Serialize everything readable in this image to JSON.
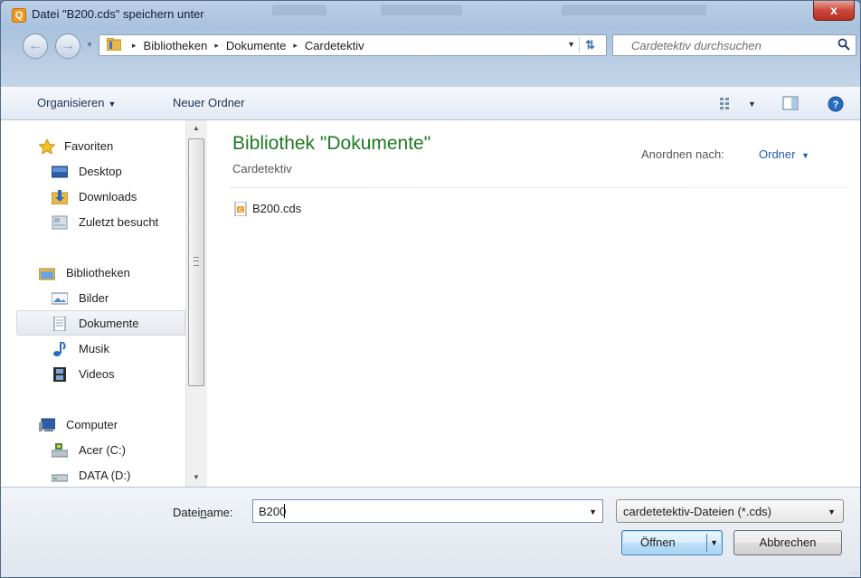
{
  "window": {
    "title": "Datei \"B200.cds\" speichern unter",
    "close_label": "x"
  },
  "address_bar": {
    "breadcrumbs": [
      "Bibliotheken",
      "Dokumente",
      "Cardetektiv"
    ],
    "separator": "▸"
  },
  "search": {
    "placeholder": "Cardetektiv durchsuchen"
  },
  "toolbar": {
    "organize_label": "Organisieren",
    "new_folder_label": "Neuer Ordner"
  },
  "nav_pane": {
    "favorites_label": "Favoriten",
    "favorites_items": [
      "Desktop",
      "Downloads",
      "Zuletzt besucht"
    ],
    "libraries_label": "Bibliotheken",
    "libraries_items": [
      "Bilder",
      "Dokumente",
      "Musik",
      "Videos"
    ],
    "computer_label": "Computer",
    "computer_items": [
      "Acer (C:)",
      "DATA (D:)"
    ],
    "selected_item": "Dokumente"
  },
  "content": {
    "library_title": "Bibliothek \"Dokumente\"",
    "library_subtitle": "Cardetektiv",
    "arrange_label": "Anordnen nach:",
    "arrange_value": "Ordner",
    "files": [
      "B200.cds"
    ]
  },
  "bottom": {
    "filename_label_pre": "Datei",
    "filename_label_underlined": "n",
    "filename_label_post": "ame:",
    "filename_value": "B200",
    "filetype_value": "cardetetektiv-Dateien (*.cds)",
    "open_button_label": "Öffnen",
    "cancel_button_label": "Abbrechen"
  },
  "colors": {
    "library_title": "#1e7a22",
    "link_blue": "#1d5fb4",
    "close_red": "#c9483a"
  },
  "icons": {
    "back": "back-arrow-icon",
    "forward": "forward-arrow-icon",
    "refresh": "refresh-icon",
    "search": "magnifier-icon",
    "views": "views-icon",
    "preview_pane": "preview-pane-icon",
    "help": "help-icon"
  }
}
